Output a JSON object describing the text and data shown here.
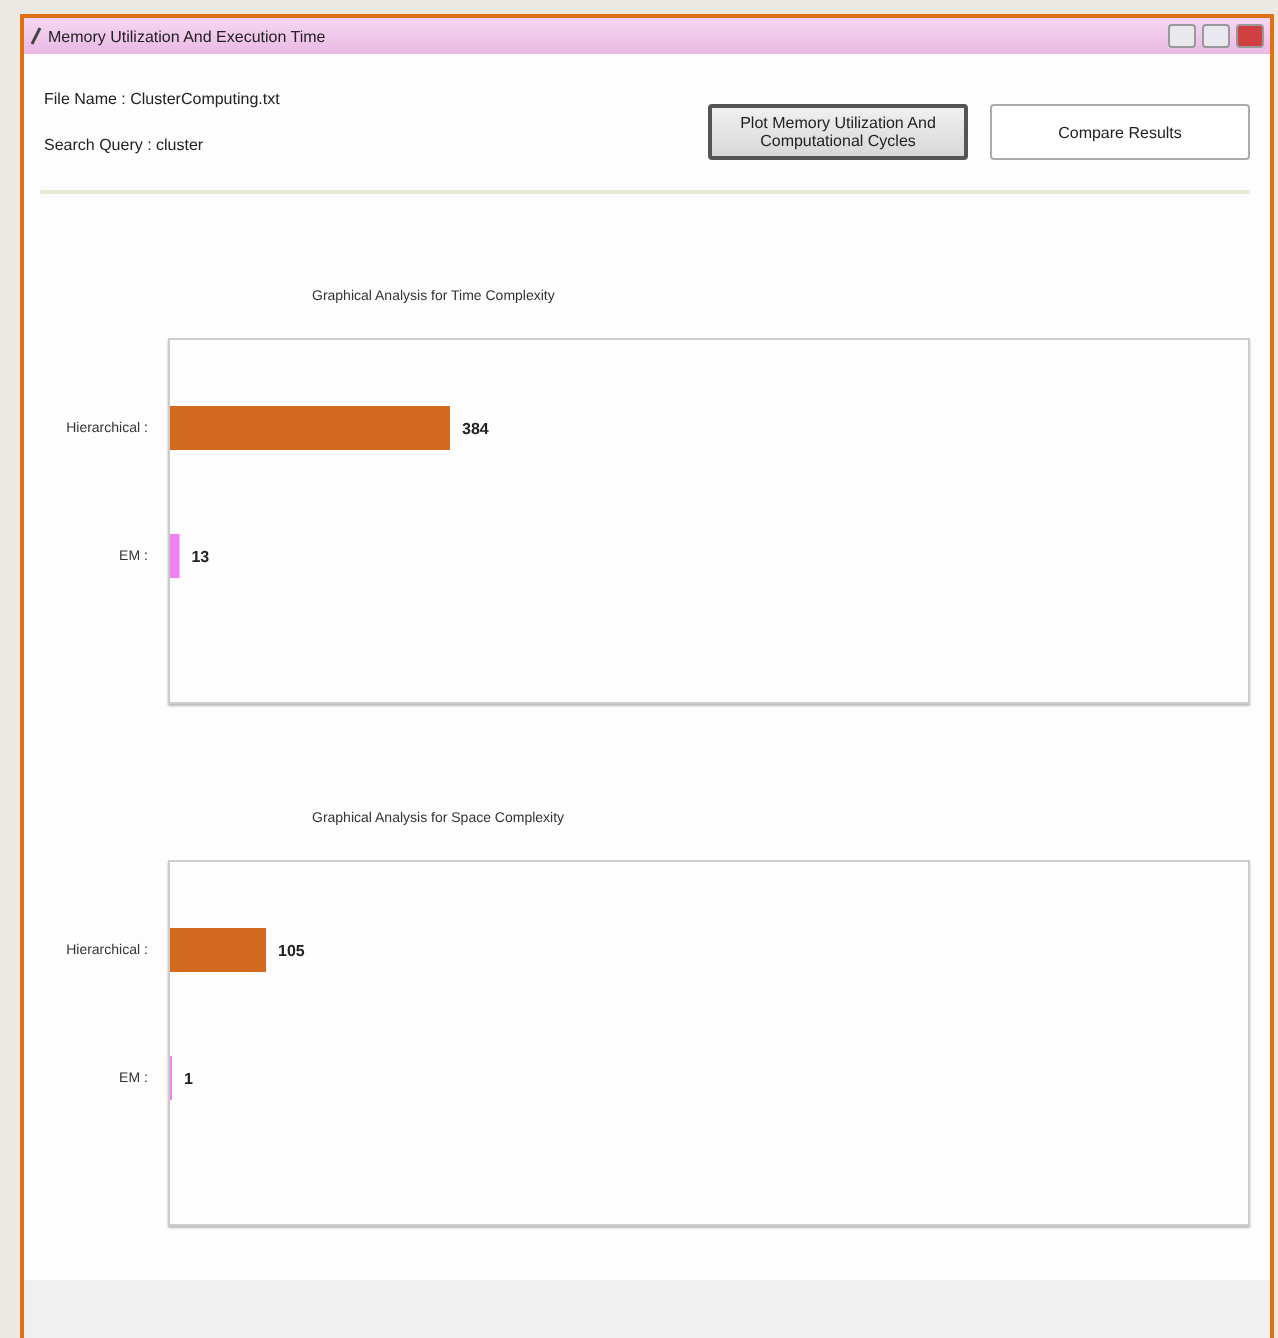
{
  "window": {
    "title": "Memory Utilization And Execution Time"
  },
  "info": [
    {
      "label": "File Name : ClusterComputing.txt"
    },
    {
      "label": "Search Query : cluster"
    }
  ],
  "buttons": [
    {
      "label": "Plot Memory Utilization And Computational Cycles",
      "selected": true
    },
    {
      "label": "Compare Results",
      "selected": false
    }
  ],
  "charts": [
    {
      "title": "Graphical Analysis for Time Complexity",
      "chart_data": {
        "type": "bar",
        "orientation": "horizontal",
        "categories": [
          "Hierarchical",
          "EM"
        ],
        "values": [
          384,
          13
        ],
        "data_labels": true
      },
      "label_separator": ":"
    },
    {
      "title": "Graphical Analysis for Space Complexity",
      "chart_data": {
        "type": "bar",
        "orientation": "horizontal",
        "categories": [
          "Hierarchical",
          "EM"
        ],
        "values": [
          105,
          1
        ],
        "data_labels": true
      },
      "label_separator": ":"
    }
  ]
}
